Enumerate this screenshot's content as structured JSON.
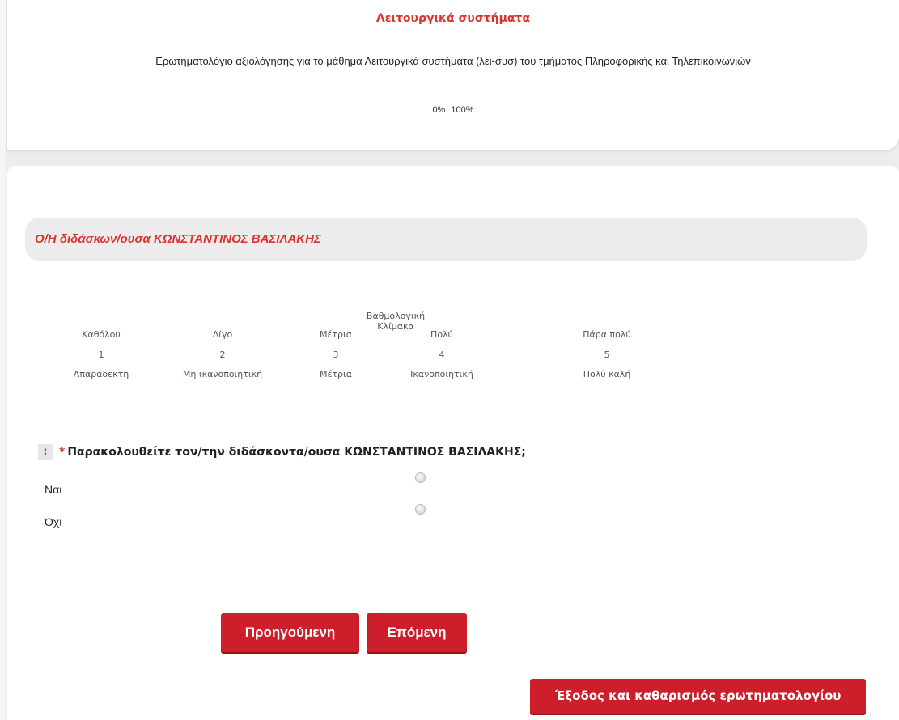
{
  "survey": {
    "title": "Λειτουργικά συστήματα",
    "description": "Ερωτηματολόγιο αξιολόγησης για το μάθημα Λειτουργικά συστήματα (λει-συσ) του τμήματος Πληροφορικής και Τηλεπικοινωνιών",
    "progress_start": "0%",
    "progress_end": "100%"
  },
  "group": {
    "title": "Ο/Η διδάσκων/ουσα ΚΩΝΣΤΑΝΤΙΝΟΣ ΒΑΣΙΛΑΚΗΣ"
  },
  "scale": {
    "title": "Βαθμολογική Κλίμακα",
    "labels": [
      "Καθόλου",
      "Λίγο",
      "Μέτρια",
      "Πολύ",
      "Πάρα πολύ"
    ],
    "numbers": [
      "1",
      "2",
      "3",
      "4",
      "5"
    ],
    "descriptions": [
      "Απαράδεκτη",
      "Μη ικανοποιητική",
      "Μέτρια",
      "Ικανοποιητική",
      "Πολύ καλή"
    ]
  },
  "question": {
    "marker": ":",
    "required_mark": "*",
    "text": "Παρακολουθείτε τον/την διδάσκοντα/ουσα ΚΩΝΣΤΑΝΤΙΝΟΣ ΒΑΣΙΛΑΚΗΣ;",
    "options": [
      "Ναι",
      "Όχι"
    ]
  },
  "buttons": {
    "prev_label": "Προηγούμενη",
    "next_label": "Επόμενη",
    "exit_label": "Έξοδος και καθαρισμός ερωτηματολογίου"
  },
  "colors": {
    "accent": "#d9352e",
    "button": "#cc1f2b"
  }
}
